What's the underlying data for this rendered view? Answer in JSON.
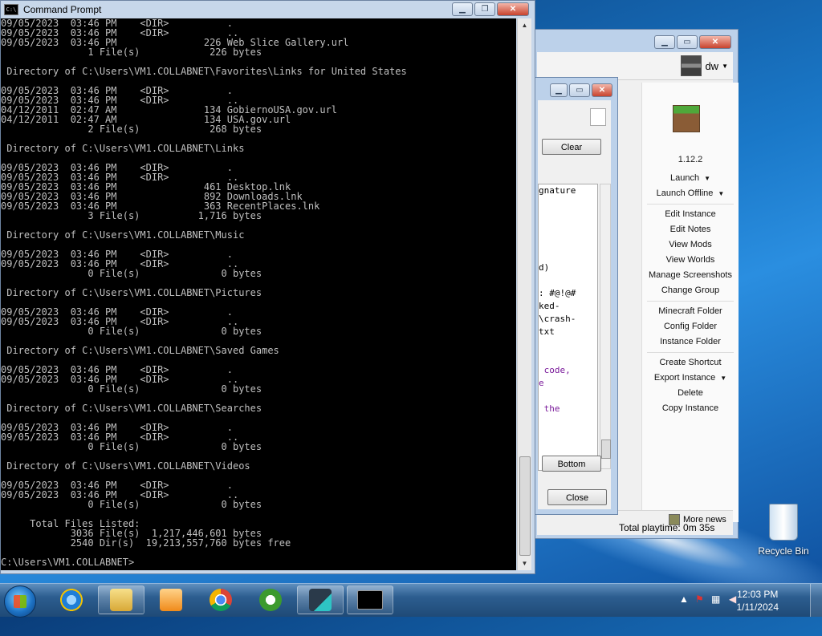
{
  "desktop": {
    "recycle_bin_label": "Recycle Bin"
  },
  "multimc": {
    "account": "dw",
    "version": "1.12.2",
    "actions": [
      {
        "label": "Launch",
        "dropdown": true
      },
      {
        "label": "Launch Offline",
        "dropdown": true
      },
      {
        "sep": true
      },
      {
        "label": "Edit Instance"
      },
      {
        "label": "Edit Notes"
      },
      {
        "label": "View Mods"
      },
      {
        "label": "View Worlds"
      },
      {
        "label": "Manage Screenshots"
      },
      {
        "label": "Change Group"
      },
      {
        "sep": true
      },
      {
        "label": "Minecraft Folder"
      },
      {
        "label": "Config Folder"
      },
      {
        "label": "Instance Folder"
      },
      {
        "sep": true
      },
      {
        "label": "Create Shortcut"
      },
      {
        "label": "Export Instance",
        "dropdown": true
      },
      {
        "label": "Delete"
      },
      {
        "label": "Copy Instance"
      }
    ],
    "more_news": "More news",
    "playtime": "Total playtime: 0m 35s"
  },
  "log_window": {
    "clear_label": "Clear",
    "bottom_label": "Bottom",
    "close_label": "Close",
    "lines": [
      {
        "t": "gnature",
        "c": ""
      },
      {
        "t": "",
        "c": ""
      },
      {
        "t": "",
        "c": ""
      },
      {
        "t": "",
        "c": ""
      },
      {
        "t": "",
        "c": ""
      },
      {
        "t": "",
        "c": ""
      },
      {
        "t": "d)",
        "c": ""
      },
      {
        "t": "",
        "c": ""
      },
      {
        "t": ": #@!@#",
        "c": ""
      },
      {
        "t": "ked-",
        "c": ""
      },
      {
        "t": "\\crash-",
        "c": ""
      },
      {
        "t": "txt",
        "c": ""
      },
      {
        "t": "",
        "c": ""
      },
      {
        "t": "",
        "c": ""
      },
      {
        "t": " code,",
        "c": "pur"
      },
      {
        "t": "e",
        "c": "pur"
      },
      {
        "t": "",
        "c": ""
      },
      {
        "t": " the",
        "c": "pur"
      }
    ]
  },
  "cmd": {
    "title": "Command Prompt",
    "lines": [
      "09/05/2023  03:46 PM    <DIR>          .",
      "09/05/2023  03:46 PM    <DIR>          ..",
      "09/05/2023  03:46 PM               226 Web Slice Gallery.url",
      "               1 File(s)            226 bytes",
      "",
      " Directory of C:\\Users\\VM1.COLLABNET\\Favorites\\Links for United States",
      "",
      "09/05/2023  03:46 PM    <DIR>          .",
      "09/05/2023  03:46 PM    <DIR>          ..",
      "04/12/2011  02:47 AM               134 GobiernoUSA.gov.url",
      "04/12/2011  02:47 AM               134 USA.gov.url",
      "               2 File(s)            268 bytes",
      "",
      " Directory of C:\\Users\\VM1.COLLABNET\\Links",
      "",
      "09/05/2023  03:46 PM    <DIR>          .",
      "09/05/2023  03:46 PM    <DIR>          ..",
      "09/05/2023  03:46 PM               461 Desktop.lnk",
      "09/05/2023  03:46 PM               892 Downloads.lnk",
      "09/05/2023  03:46 PM               363 RecentPlaces.lnk",
      "               3 File(s)          1,716 bytes",
      "",
      " Directory of C:\\Users\\VM1.COLLABNET\\Music",
      "",
      "09/05/2023  03:46 PM    <DIR>          .",
      "09/05/2023  03:46 PM    <DIR>          ..",
      "               0 File(s)              0 bytes",
      "",
      " Directory of C:\\Users\\VM1.COLLABNET\\Pictures",
      "",
      "09/05/2023  03:46 PM    <DIR>          .",
      "09/05/2023  03:46 PM    <DIR>          ..",
      "               0 File(s)              0 bytes",
      "",
      " Directory of C:\\Users\\VM1.COLLABNET\\Saved Games",
      "",
      "09/05/2023  03:46 PM    <DIR>          .",
      "09/05/2023  03:46 PM    <DIR>          ..",
      "               0 File(s)              0 bytes",
      "",
      " Directory of C:\\Users\\VM1.COLLABNET\\Searches",
      "",
      "09/05/2023  03:46 PM    <DIR>          .",
      "09/05/2023  03:46 PM    <DIR>          ..",
      "               0 File(s)              0 bytes",
      "",
      " Directory of C:\\Users\\VM1.COLLABNET\\Videos",
      "",
      "09/05/2023  03:46 PM    <DIR>          .",
      "09/05/2023  03:46 PM    <DIR>          ..",
      "               0 File(s)              0 bytes",
      "",
      "     Total Files Listed:",
      "            3036 File(s)  1,217,446,601 bytes",
      "            2540 Dir(s)  19,213,557,760 bytes free",
      "",
      "C:\\Users\\VM1.COLLABNET>"
    ]
  },
  "taskbar": {
    "apps": [
      {
        "name": "internet-explorer",
        "active": false
      },
      {
        "name": "file-explorer",
        "active": true
      },
      {
        "name": "media-player",
        "active": false
      },
      {
        "name": "chrome",
        "active": false
      },
      {
        "name": "utorrent",
        "active": false
      },
      {
        "name": "multimc",
        "active": true
      },
      {
        "name": "command-prompt",
        "active": true
      }
    ],
    "time": "12:03 PM",
    "date": "1/11/2024"
  }
}
